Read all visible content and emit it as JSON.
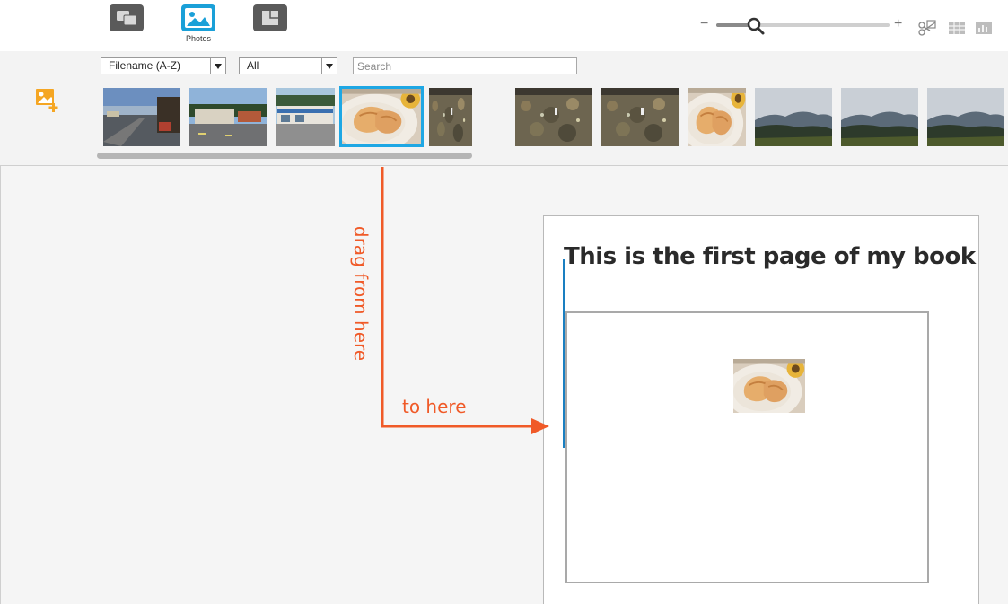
{
  "toolbar": {
    "modes": [
      {
        "name": "layouts",
        "label": "",
        "icon": "layouts-icon"
      },
      {
        "name": "photos",
        "label": "Photos",
        "icon": "photos-icon",
        "active": true
      },
      {
        "name": "backgrounds",
        "label": "",
        "icon": "backgrounds-icon"
      }
    ],
    "zoom": {
      "minus": "−",
      "plus": "+",
      "level": 0.22
    },
    "views": [
      "crop-tools-icon",
      "grid-view-icon",
      "stats-view-icon"
    ]
  },
  "filters": {
    "sort": {
      "value": "Filename (A-Z)"
    },
    "type": {
      "value": "All"
    },
    "search": {
      "placeholder": "Search",
      "value": ""
    }
  },
  "thumbnails": [
    {
      "subject": "street-scene",
      "selected": false
    },
    {
      "subject": "roadside-building",
      "selected": false
    },
    {
      "subject": "storefront",
      "selected": false
    },
    {
      "subject": "pastry-plate",
      "selected": true
    },
    {
      "subject": "ground-closeup",
      "selected": false
    },
    {
      "subject": "ground-closeup",
      "selected": false
    },
    {
      "subject": "ground-closeup",
      "selected": false
    },
    {
      "subject": "pastry-plate",
      "selected": false
    },
    {
      "subject": "mountain-landscape",
      "selected": false
    },
    {
      "subject": "mountain-landscape",
      "selected": false
    },
    {
      "subject": "mountain-landscape",
      "selected": false
    }
  ],
  "page": {
    "title": "This is the first page of my book",
    "dragged_photo": "pastry-plate"
  },
  "annotations": {
    "drag_from": "drag from here",
    "drop_to": "to here",
    "color": "#f05a28"
  },
  "colors": {
    "accent": "#1ea7e4",
    "add_icon": "#f5a623"
  }
}
